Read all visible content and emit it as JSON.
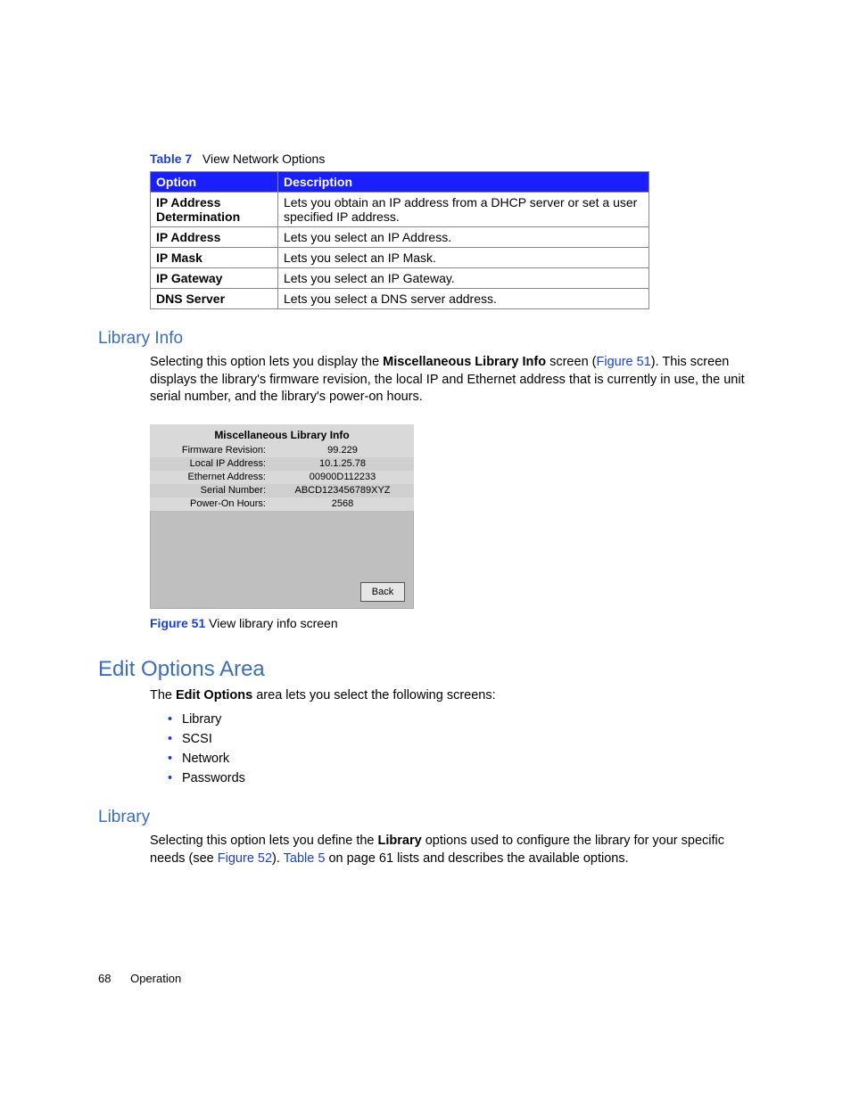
{
  "table": {
    "label": "Table 7",
    "title": "View Network Options",
    "headers": {
      "c0": "Option",
      "c1": "Description"
    },
    "rows": [
      {
        "opt": "IP Address Determination",
        "desc": "Lets you obtain an IP address from a DHCP server or set a user specified IP address."
      },
      {
        "opt": "IP Address",
        "desc": "Lets you select an IP Address."
      },
      {
        "opt": "IP Mask",
        "desc": "Lets you select an IP Mask."
      },
      {
        "opt": "IP Gateway",
        "desc": "Lets you select an IP Gateway."
      },
      {
        "opt": "DNS Server",
        "desc": "Lets you select a DNS server address."
      }
    ]
  },
  "section_library_info": {
    "heading": "Library Info",
    "p_pre": "Selecting this option lets you display the ",
    "p_bold": "Miscellaneous Library Info",
    "p_mid": " screen (",
    "p_link": "Figure 51",
    "p_post": "). This screen displays the library's firmware revision, the local IP and Ethernet address that is currently in use, the unit serial number, and the library's power-on hours."
  },
  "mini": {
    "title": "Miscellaneous Library Info",
    "rows": [
      {
        "lab": "Firmware Revision:",
        "val": "99.229"
      },
      {
        "lab": "Local IP Address:",
        "val": "10.1.25.78"
      },
      {
        "lab": "Ethernet Address:",
        "val": "00900D112233"
      },
      {
        "lab": "Serial Number:",
        "val": "ABCD123456789XYZ"
      },
      {
        "lab": "Power-On Hours:",
        "val": "2568"
      }
    ],
    "back": "Back"
  },
  "figure": {
    "label": "Figure 51",
    "caption": "View library info screen"
  },
  "section_edit": {
    "heading": "Edit Options Area",
    "p_pre": "The ",
    "p_bold": "Edit Options",
    "p_post": " area lets you select the following screens:",
    "items": [
      "Library",
      "SCSI",
      "Network",
      "Passwords"
    ]
  },
  "section_library": {
    "heading": "Library",
    "p_pre": "Selecting this option lets you define the ",
    "p_bold": "Library",
    "p_mid": " options used to configure the library for your specific needs (see ",
    "p_link1": "Figure 52",
    "p_sep": "). ",
    "p_link2": "Table 5",
    "p_post": " on page 61 lists and describes the available options."
  },
  "footer": {
    "page": "68",
    "section": "Operation"
  }
}
